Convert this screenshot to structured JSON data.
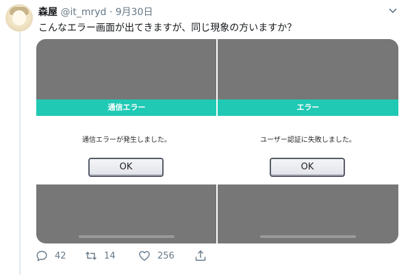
{
  "tweet": {
    "author_name": "森屋",
    "handle": "@it_mryd",
    "separator": "·",
    "date": "9月30日",
    "text": "こんなエラー画面が出てきますが、同じ現象の方いますか？"
  },
  "media": {
    "left_panel": {
      "title": "通信エラー",
      "message": "通信エラーが発生しました。",
      "button_label": "OK"
    },
    "right_panel": {
      "title": "エラー",
      "message": "ユーザー認証に失敗しました。",
      "button_label": "OK"
    },
    "colors": {
      "dialog_header": "#20c9b4",
      "backdrop": "#777777"
    }
  },
  "actions": {
    "replies": "42",
    "retweets": "14",
    "likes": "256",
    "icons": [
      "reply-icon",
      "retweet-icon",
      "like-icon",
      "share-icon"
    ]
  }
}
